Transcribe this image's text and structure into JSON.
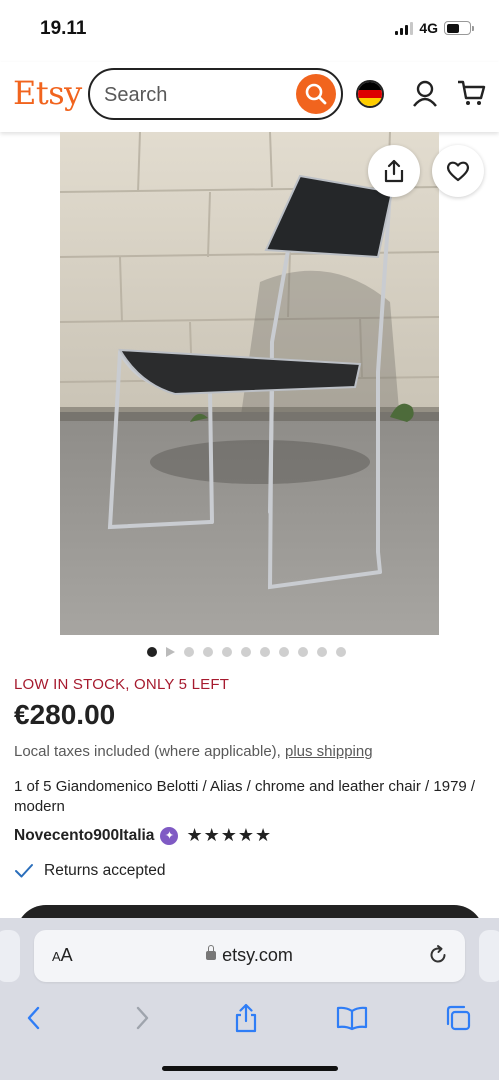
{
  "status": {
    "time": "19.11",
    "network": "4G",
    "battery_level": 0.55
  },
  "header": {
    "logo": "Etsy",
    "search_placeholder": "Search",
    "brand_color": "#f1641e",
    "icons": [
      "search-icon",
      "germany-flag-icon",
      "user-icon",
      "cart-icon"
    ]
  },
  "gallery": {
    "image_alt": "Black leather and chrome chair standing in front of a stone wall",
    "icons": [
      "share-icon",
      "heart-icon"
    ],
    "dot_count": 11,
    "active_dot": 0
  },
  "product": {
    "stock_notice": "LOW IN STOCK, ONLY 5 LEFT",
    "price": "€280.00",
    "taxes_text": "Local taxes included (where applicable), ",
    "shipping_link": "plus shipping",
    "title": "1 of 5 Giandomenico Belotti / Alias / chrome and leather chair / 1979 / modern",
    "shop_name": "Novecento900Italia",
    "rating_stars": "★★★★★",
    "rating_value": 5,
    "returns_text": "Returns accepted"
  },
  "browser": {
    "aa_label": "AA",
    "url": "etsy.com",
    "toolbar_icons": [
      "back-icon",
      "forward-icon",
      "share-icon",
      "bookmarks-icon",
      "tabs-icon"
    ]
  }
}
